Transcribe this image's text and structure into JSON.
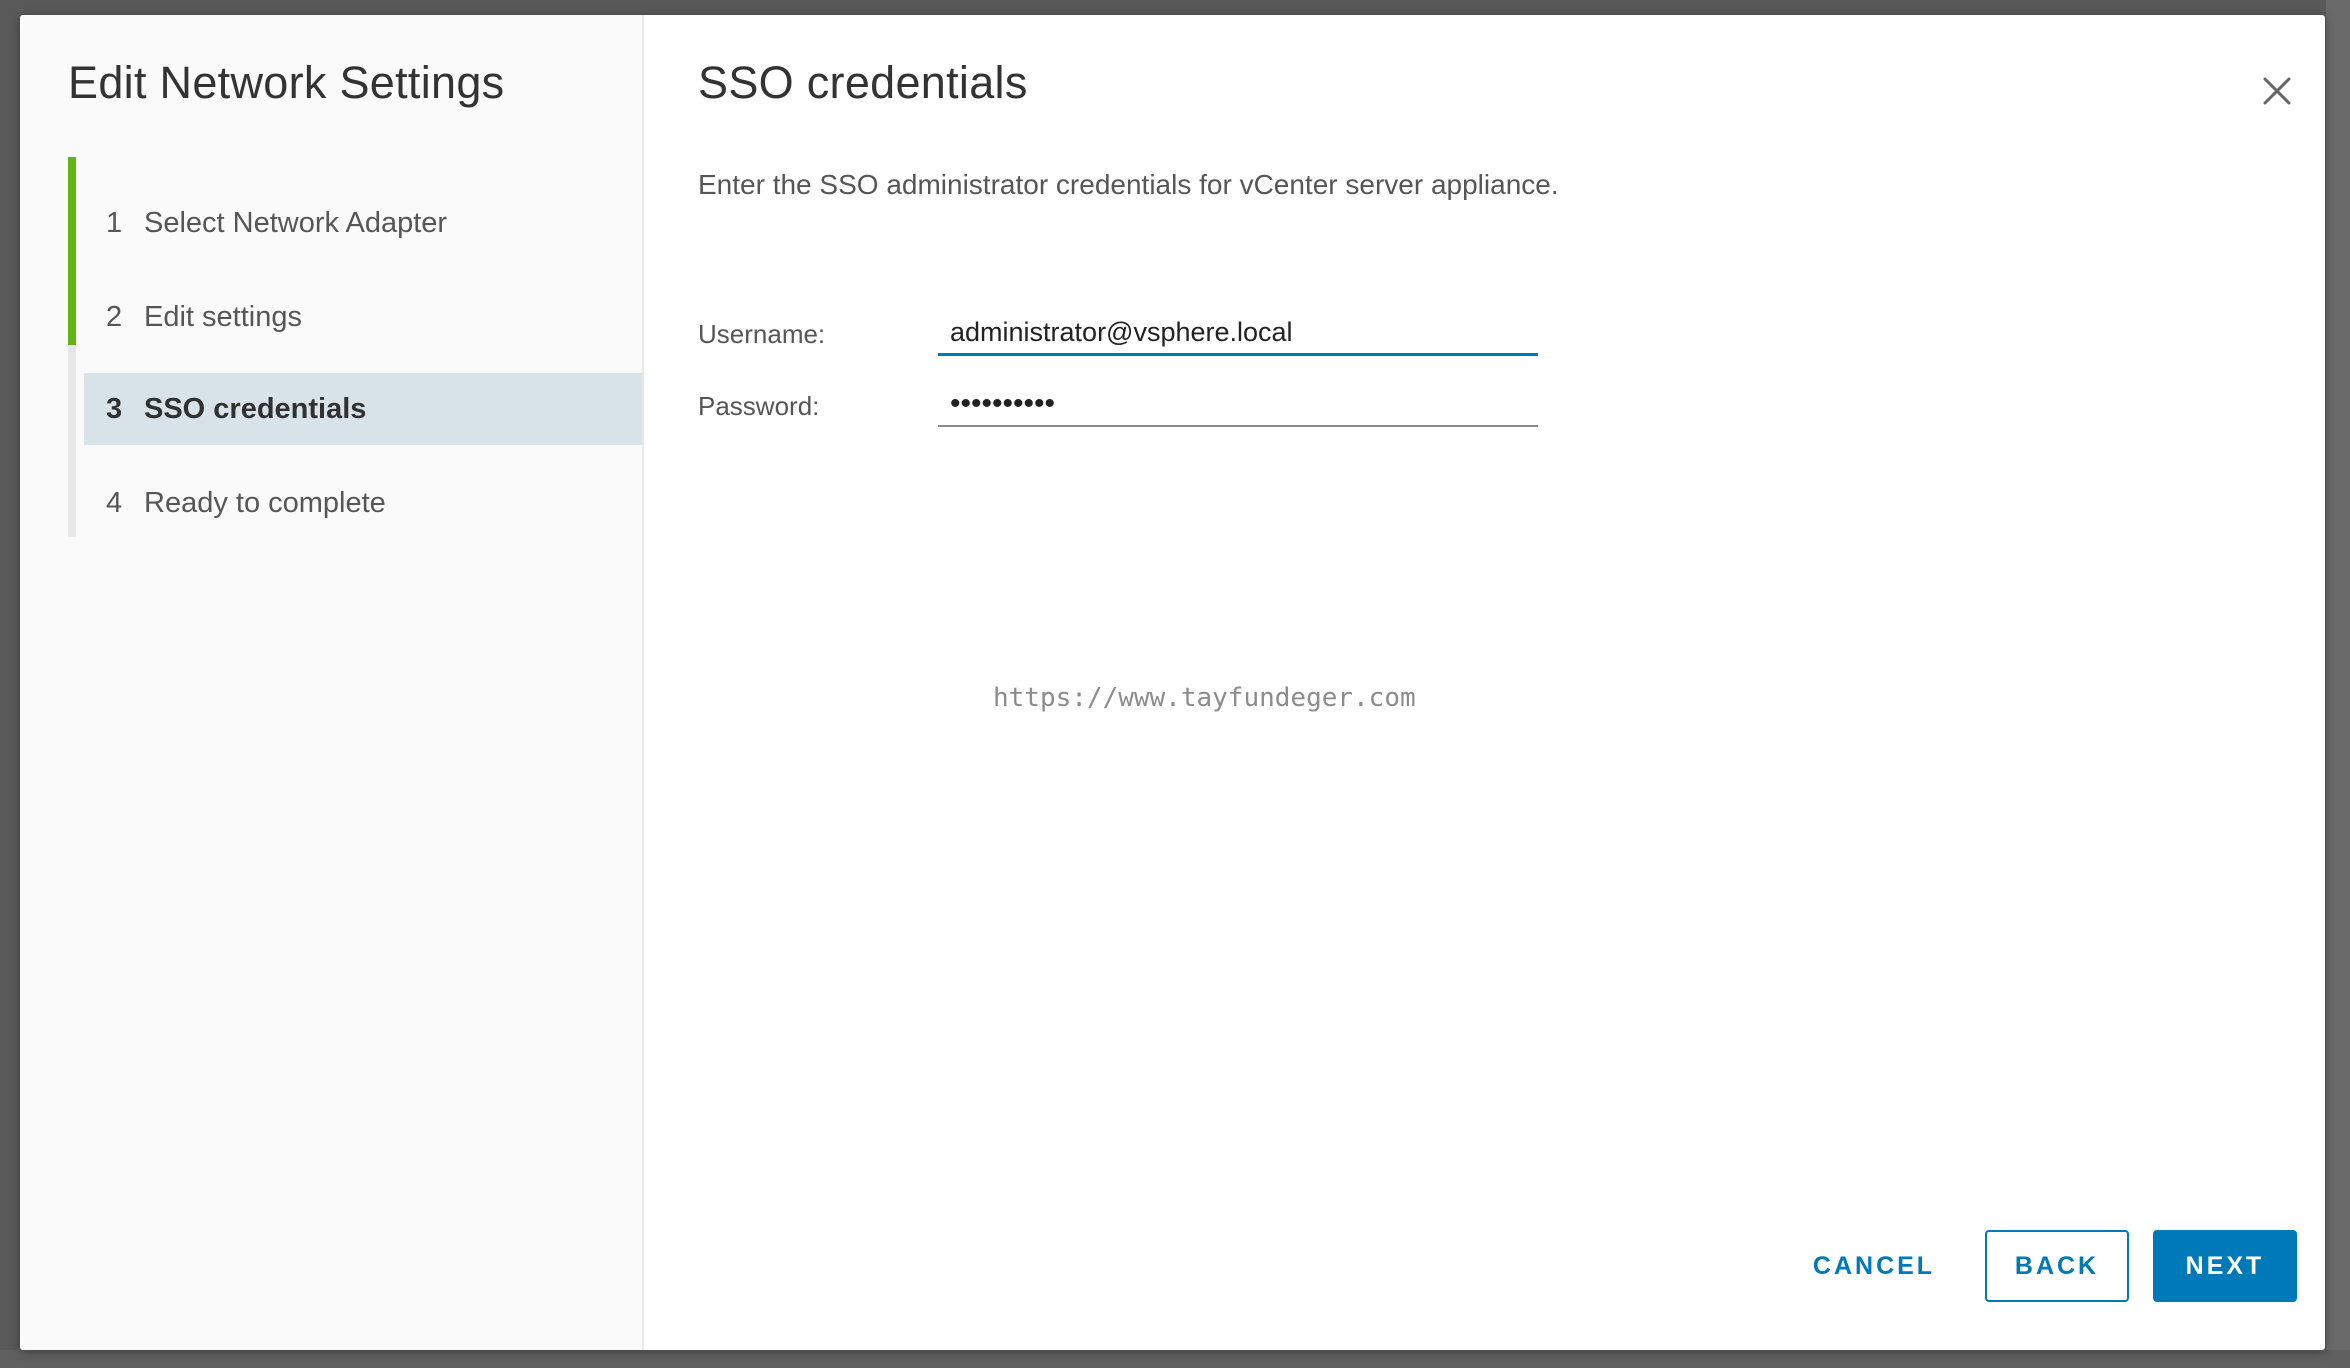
{
  "wizard": {
    "title": "Edit Network Settings",
    "steps": [
      {
        "number": "1",
        "label": "Select Network Adapter",
        "state": "completed"
      },
      {
        "number": "2",
        "label": "Edit settings",
        "state": "completed"
      },
      {
        "number": "3",
        "label": "SSO credentials",
        "state": "active"
      },
      {
        "number": "4",
        "label": "Ready to complete",
        "state": "pending"
      }
    ]
  },
  "page": {
    "title": "SSO credentials",
    "description": "Enter the SSO administrator credentials for vCenter server appliance."
  },
  "form": {
    "username_label": "Username:",
    "username_value": "administrator@vsphere.local",
    "password_label": "Password:",
    "password_masked": "••••••••••"
  },
  "watermark": "https://www.tayfundeger.com",
  "buttons": {
    "cancel": "CANCEL",
    "back": "BACK",
    "next": "NEXT"
  },
  "colors": {
    "accent": "#0079b8",
    "step_done": "#60b515",
    "step_active_bg": "#d8e3e9"
  },
  "icons": {
    "close": "close-icon"
  }
}
